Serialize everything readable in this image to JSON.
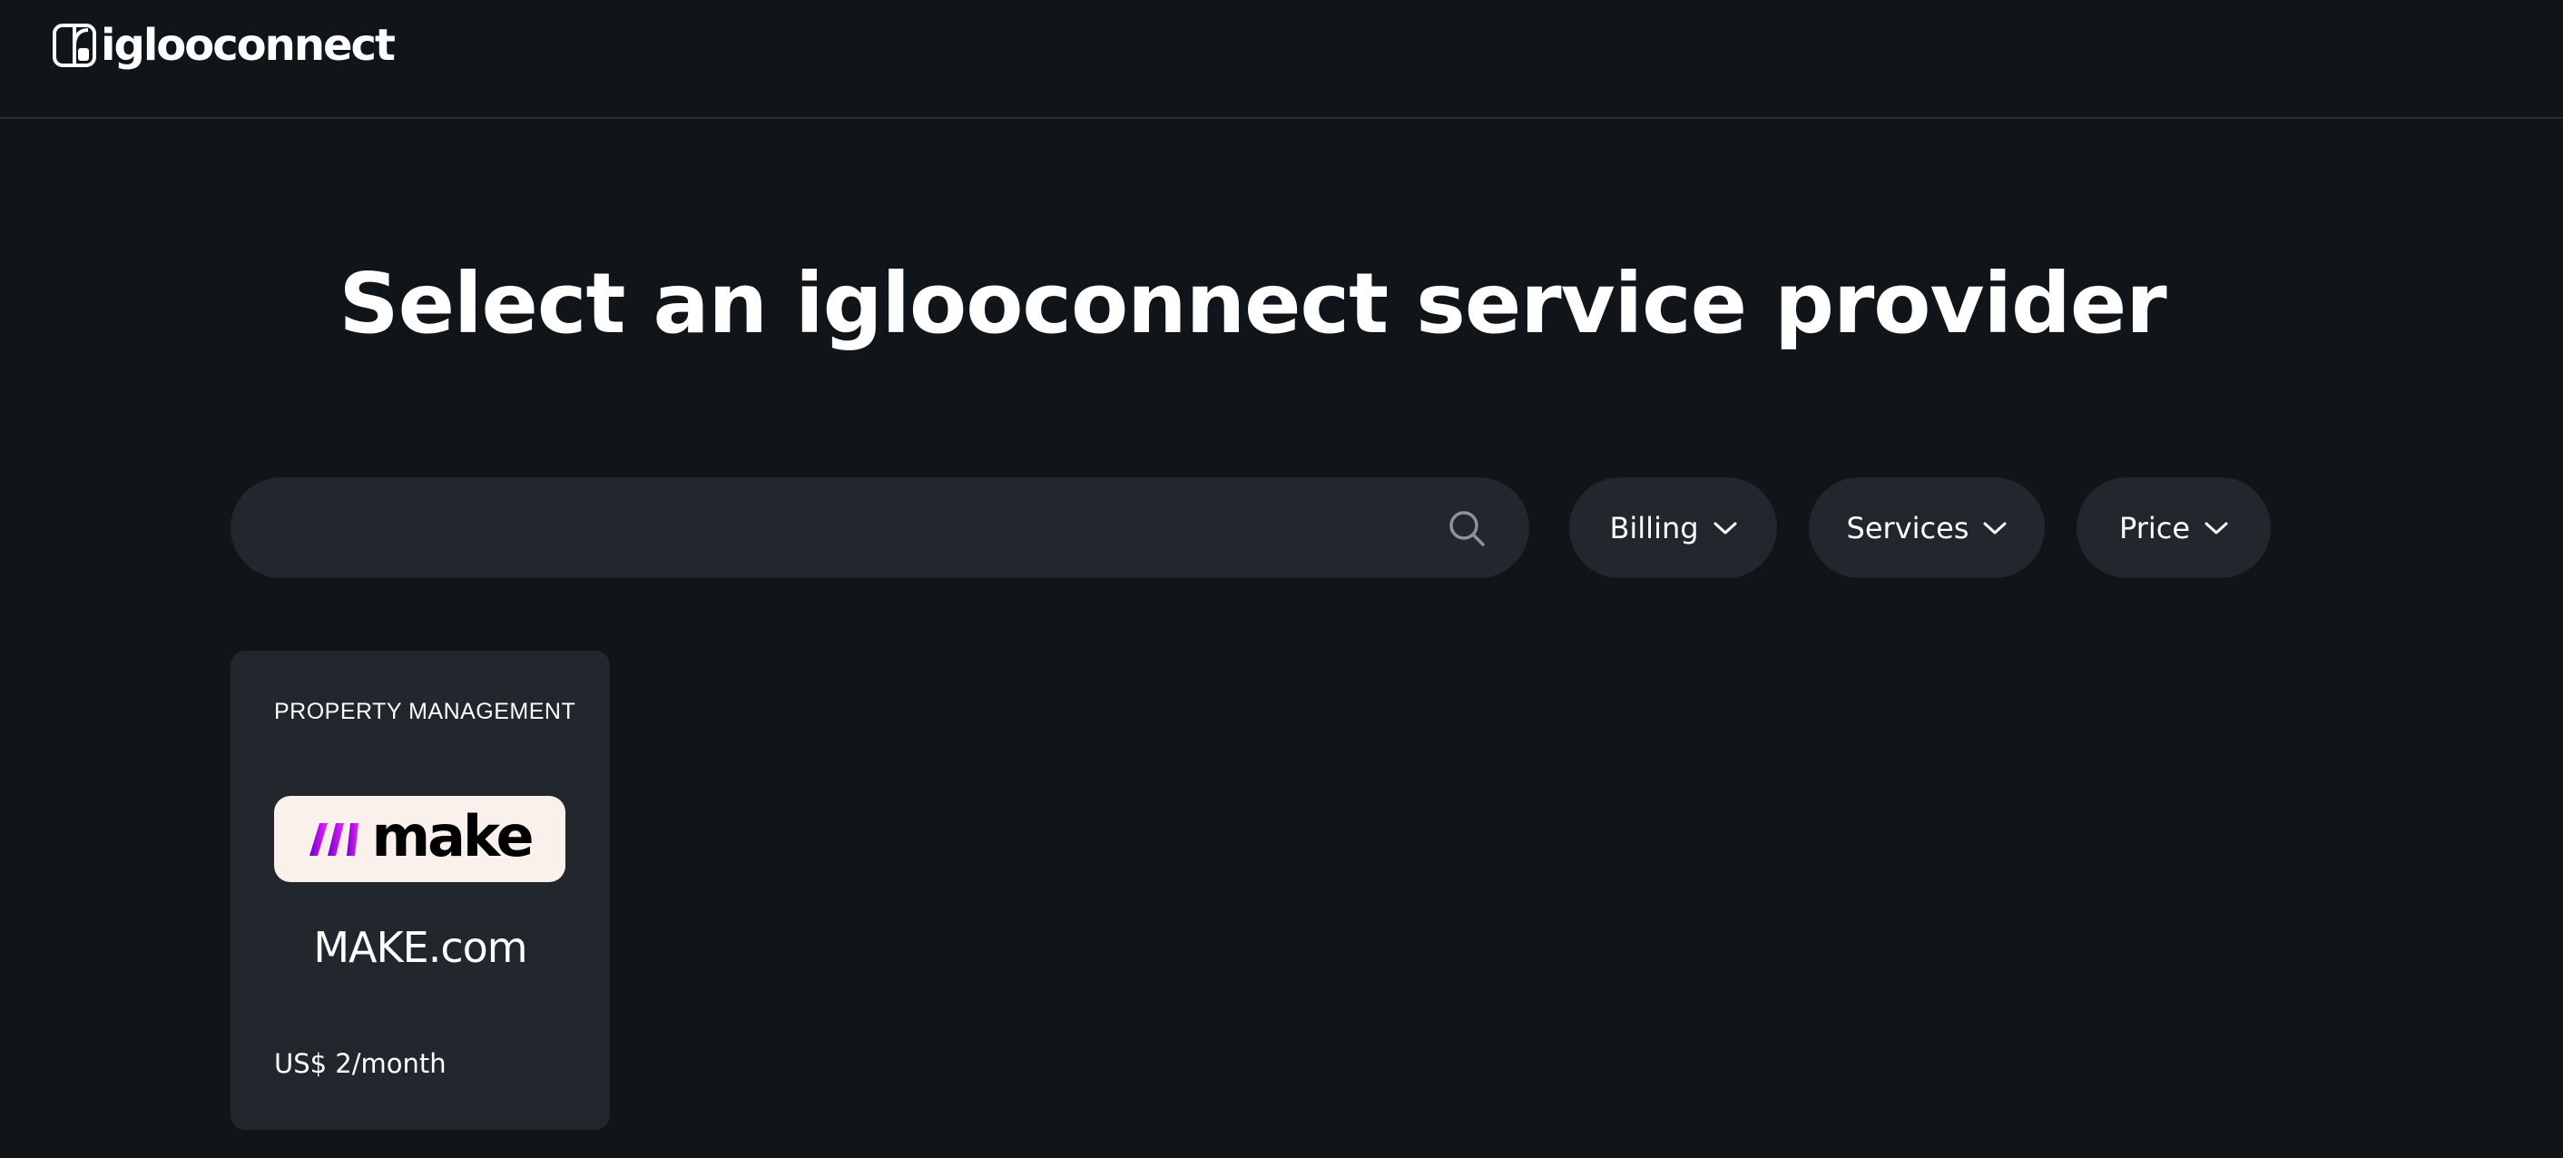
{
  "brand": {
    "name": "iglooconnect",
    "logo_icon": "igloo-logo-icon"
  },
  "page": {
    "title": "Select an iglooconnect service provider"
  },
  "search": {
    "value": "",
    "placeholder": "",
    "icon": "search-icon"
  },
  "filters": [
    {
      "label": "Billing",
      "icon": "chevron-down-icon"
    },
    {
      "label": "Services",
      "icon": "chevron-down-icon"
    },
    {
      "label": "Price",
      "icon": "chevron-down-icon"
    }
  ],
  "providers": [
    {
      "category": "PROPERTY MANAGEMENT",
      "logo_text": "make",
      "name": "MAKE.com",
      "price": "US$ 2/month"
    }
  ],
  "colors": {
    "background": "#101519",
    "surface": "#21272d",
    "divider": "#2a3036",
    "text": "#ffffff",
    "logo_bg": "#faf1ec",
    "make_gradient_start": "#6d00cc",
    "make_gradient_end": "#f024f6"
  }
}
